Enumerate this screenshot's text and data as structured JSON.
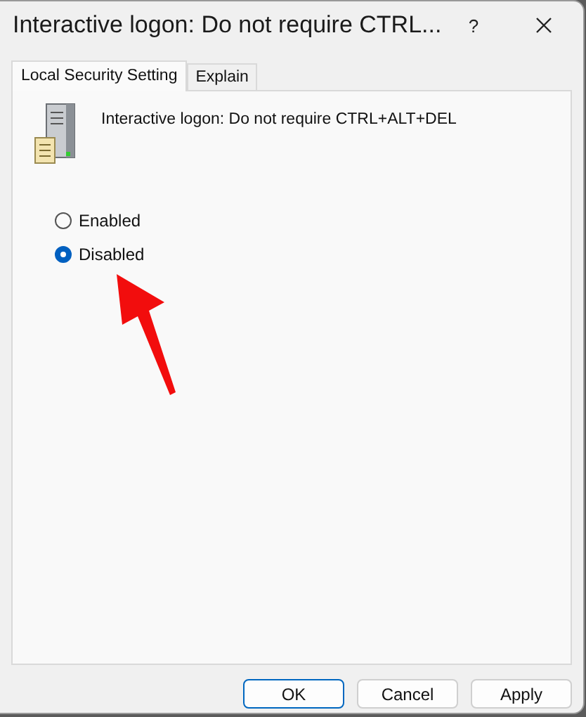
{
  "window": {
    "title": "Interactive logon: Do not require CTRL...",
    "help": "?"
  },
  "tabs": [
    {
      "label": "Local Security Setting",
      "selected": true
    },
    {
      "label": "Explain",
      "selected": false
    }
  ],
  "policy": {
    "name": "Interactive logon: Do not require CTRL+ALT+DEL"
  },
  "options": [
    {
      "label": "Enabled",
      "selected": false
    },
    {
      "label": "Disabled",
      "selected": true
    }
  ],
  "buttons": [
    {
      "label": "OK",
      "default": true
    },
    {
      "label": "Cancel",
      "default": false
    },
    {
      "label": "Apply",
      "default": false
    }
  ]
}
